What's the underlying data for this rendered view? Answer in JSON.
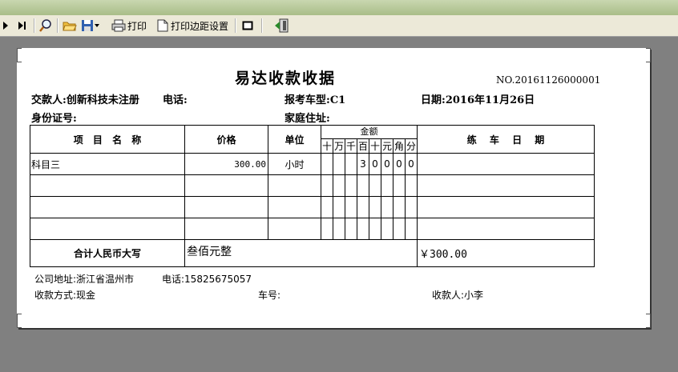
{
  "toolbar": {
    "print_label": "打印",
    "margin_label": "打印边距设置"
  },
  "receipt": {
    "title": "易达收款收据",
    "number": "NO.20161126000001",
    "payer_label": "交款人:",
    "payer": "创新科技未注册",
    "phone_label": "电话:",
    "exam_type_label": "报考车型:",
    "exam_type": "C1",
    "date_label": "日期:",
    "date": "2016年11月26日",
    "id_label": "身份证号:",
    "address_label": "家庭住址:",
    "columns": {
      "item": "项 目 名 称",
      "price": "价格",
      "unit": "单位",
      "amount": "金额",
      "digits": [
        "十",
        "万",
        "千",
        "百",
        "十",
        "元",
        "角",
        "分"
      ],
      "practice_date": "练 车 日 期"
    },
    "rows": [
      {
        "item": "科目三",
        "price": "300.00",
        "unit": "小时",
        "digits": [
          "",
          "",
          "",
          "3",
          "0",
          "0",
          "0",
          "0"
        ],
        "practice_date": ""
      },
      {
        "item": "",
        "price": "",
        "unit": "",
        "digits": [
          "",
          "",
          "",
          "",
          "",
          "",
          "",
          ""
        ],
        "practice_date": ""
      },
      {
        "item": "",
        "price": "",
        "unit": "",
        "digits": [
          "",
          "",
          "",
          "",
          "",
          "",
          "",
          ""
        ],
        "practice_date": ""
      },
      {
        "item": "",
        "price": "",
        "unit": "",
        "digits": [
          "",
          "",
          "",
          "",
          "",
          "",
          "",
          ""
        ],
        "practice_date": ""
      }
    ],
    "total_label": "合计人民币大写",
    "total_words": "叁佰元整",
    "total_amount": "￥300.00",
    "company_address": "公司地址:浙江省温州市",
    "company_phone": "电话:15825675057",
    "payment_method": "收款方式:现金",
    "car_no": "车号:",
    "receiver": "收款人:小李"
  }
}
